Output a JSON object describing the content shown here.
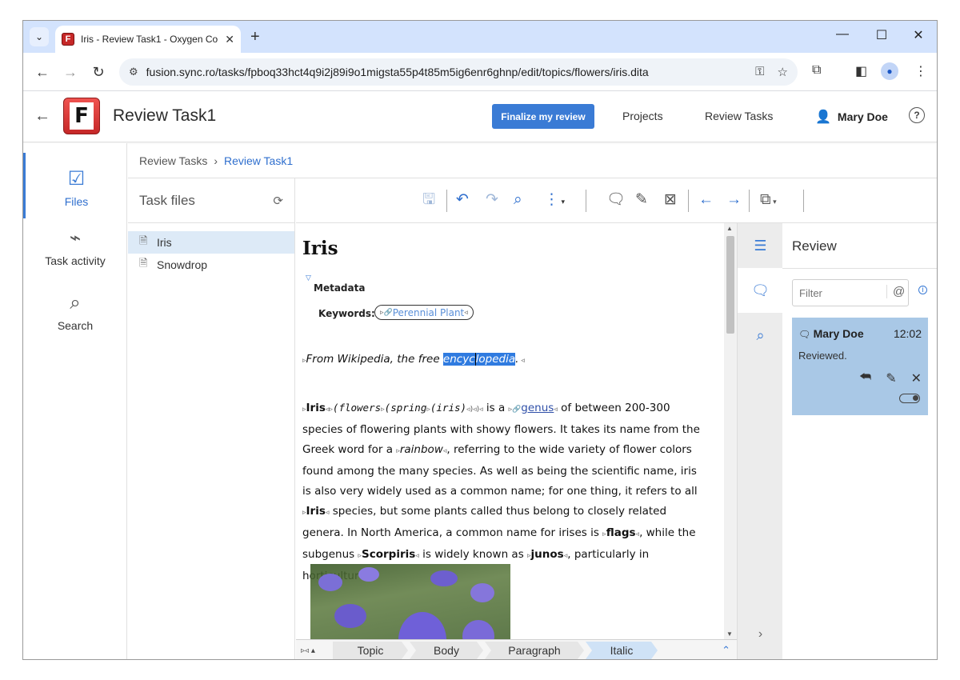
{
  "browser": {
    "tab_title": "Iris - Review Task1 - Oxygen Co",
    "url": "fusion.sync.ro/tasks/fpboq33hct4q9i2j89i9o1migsta55p4t85m5ig6enr6ghnp/edit/topics/flowers/iris.dita"
  },
  "header": {
    "logo_letter": "F",
    "title": "Review Task1",
    "finalize_label": "Finalize my review",
    "nav": [
      "Projects",
      "Review Tasks"
    ],
    "user_name": "Mary Doe",
    "help": "?"
  },
  "leftnav": [
    {
      "label": "Files",
      "icon": "checklist-icon",
      "active": true
    },
    {
      "label": "Task activity",
      "icon": "activity-icon",
      "active": false
    },
    {
      "label": "Search",
      "icon": "search-icon",
      "active": false
    }
  ],
  "breadcrumb": {
    "parent": "Review Tasks",
    "current": "Review Task1"
  },
  "task_files": {
    "title": "Task files",
    "files": [
      "Iris",
      "Snowdrop"
    ]
  },
  "document": {
    "title": "Iris",
    "metadata_label": "Metadata",
    "keywords_label": "Keywords:",
    "keyword": "Perennial Plant",
    "shortdesc_prefix": "From Wikipedia, the free ",
    "shortdesc_sel1": "encyc",
    "shortdesc_sel2": "lopedia",
    "shortdesc_suffix": ".",
    "p_iris": "Iris",
    "p_flowers": "(flowers",
    "p_spring": "(spring",
    "p_iris2": "(iris)",
    "p_isa": " is a ",
    "p_genus": "genus",
    "p_text1": " of between 200-300 species of flowering plants with showy flowers. It takes its name from the Greek word for a ",
    "p_rainbow": "rainbow",
    "p_text2": ", referring to the wide variety of flower colors found among the many species. As well as being the scientific name, iris is also very widely used as a common name; for one thing, it refers to all ",
    "p_iris3": "Iris",
    "p_text3": " species, but some plants called thus belong to closely related genera. In North America, a common name for irises is ",
    "p_flags": "flags",
    "p_text4": ", while the subgenus ",
    "p_scorpiris": "Scorpiris",
    "p_text5": " is widely known as ",
    "p_junos": "junos",
    "p_text6": ", particularly in horticulture."
  },
  "statusbar": {
    "crumbs": [
      "Topic",
      "Body",
      "Paragraph",
      "Italic"
    ]
  },
  "review": {
    "title": "Review",
    "filter_placeholder": "Filter",
    "at": "@",
    "comment": {
      "author": "Mary Doe",
      "time": "12:02",
      "text": "Reviewed."
    }
  },
  "colors": {
    "accent": "#3a7bd5",
    "selection": "#2f7be0",
    "comment_card": "#a9c8e6"
  }
}
